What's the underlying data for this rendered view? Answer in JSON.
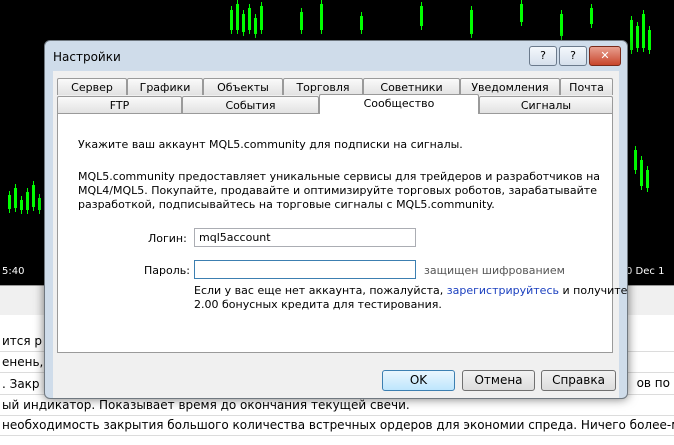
{
  "background": {
    "time_left": "5:40",
    "time_right": "0 Dec 1",
    "rows": [
      "ится р",
      "енень, к",
      ". Закр",
      "ый индикатор. Показывает время до окончания текущей свечи.",
      "необходимость закрытия большого количества встречных ордеров для экономии спреда. Ничего более-менее прос"
    ],
    "right_text": "ов по"
  },
  "dialog": {
    "title": "Настройки",
    "help_label": "?",
    "context_help_label": "?",
    "close_label": "✕",
    "tabs_row1": [
      "Сервер",
      "Графики",
      "Объекты",
      "Торговля",
      "Советники",
      "Уведомления",
      "Почта"
    ],
    "tabs_row2": [
      "FTP",
      "События",
      "Сообщество",
      "Сигналы"
    ],
    "active_tab": "Сообщество",
    "intro": "Укажите ваш аккаунт MQL5.community для подписки на сигналы.",
    "description_line1": "MQL5.community предоставляет уникальные сервисы для трейдеров и разработчиков на",
    "description_line2": "MQL4/MQL5. Покупайте, продавайте и оптимизируйте торговых роботов, зарабатывайте",
    "description_line3": "разработкой, подписывайтесь на торговые сигналы с MQL5.community.",
    "login_label": "Логин:",
    "login_value": "mql5account",
    "password_label": "Пароль:",
    "password_value": "",
    "password_note": "защищен шифрованием",
    "register_text_before": "Если у вас еще нет аккаунта, пожалуйста,",
    "register_link": "зарегистрируйтесь",
    "register_text_after": "и получите",
    "register_line2": "2.00 бонусных кредита для тестирования.",
    "ok_label": "OK",
    "cancel_label": "Отмена",
    "help_button_label": "Справка"
  },
  "colors": {
    "chart_bg": "#000000",
    "candle": "#00ff00",
    "link": "#1a3fbf",
    "frame": "#cfdcea"
  }
}
